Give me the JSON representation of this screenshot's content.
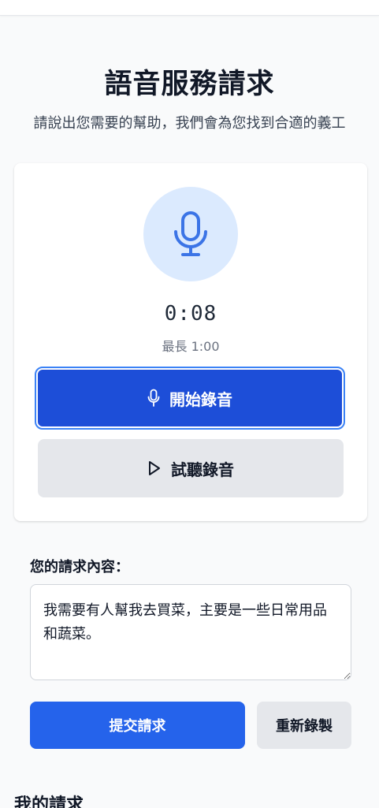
{
  "header": {
    "title": "語音服務請求",
    "subtitle": "請說出您需要的幫助，我們會為您找到合適的義工"
  },
  "recorder": {
    "mic_icon": "microphone-icon",
    "timer": "0:08",
    "max_length": "最長 1:00",
    "record_button_label": "開始錄音",
    "record_button_icon": "microphone-icon",
    "preview_button_label": "試聽錄音",
    "preview_button_icon": "play-icon"
  },
  "request": {
    "label": "您的請求內容：",
    "text": "我需要有人幫我去買菜，主要是一些日常用品和蔬菜。"
  },
  "actions": {
    "submit_label": "提交請求",
    "rerecord_label": "重新錄製"
  },
  "my_requests": {
    "heading": "我的請求"
  },
  "colors": {
    "primary": "#2563eb",
    "primary_dark": "#1d4ed8",
    "mic_bg": "#dbeafe",
    "secondary_button": "#e5e7eb"
  }
}
